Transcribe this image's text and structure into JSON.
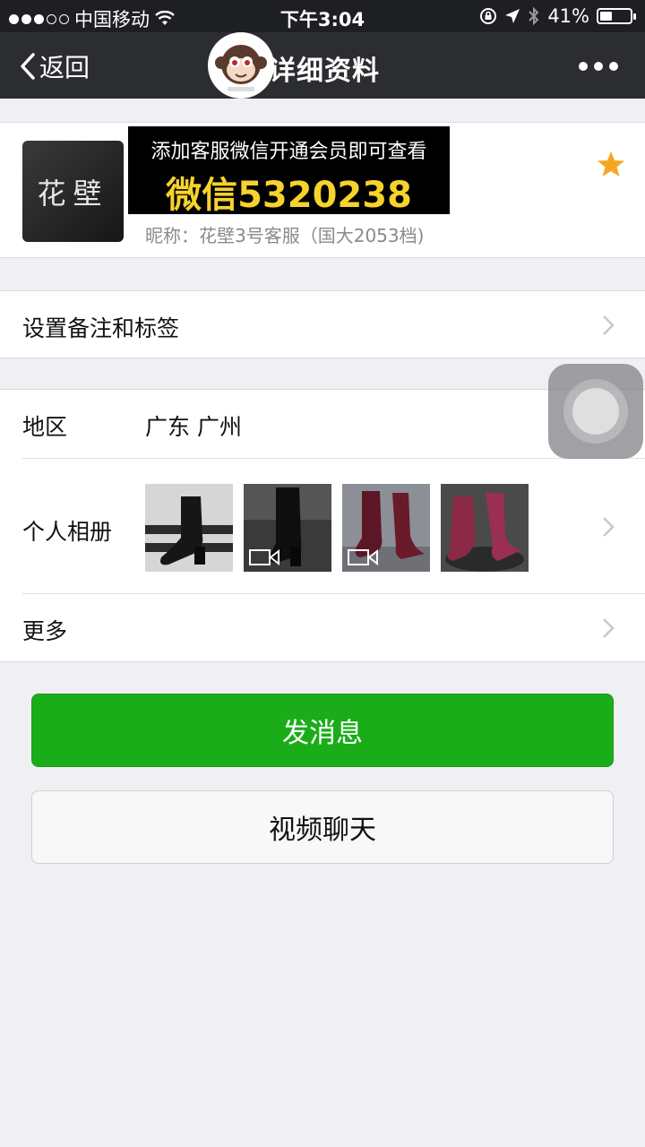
{
  "status_bar": {
    "carrier": "中国移动",
    "time": "下午3:04",
    "battery_text": "41%",
    "battery_level": 0.41
  },
  "nav": {
    "back_label": "返回",
    "title": "详细资料",
    "overlay_badge_name": "monkey-logo-icon"
  },
  "profile": {
    "avatar_text": "花壁",
    "banner_line1": "添加客服微信开通会员即可查看",
    "banner_line2": "微信5320238",
    "nickname": "昵称：花壁3号客服（国大2053档)",
    "starred": true,
    "colors": {
      "banner_bg": "#000000",
      "banner_highlight": "#f6d22c",
      "star": "#f5a623"
    }
  },
  "settings": {
    "remark_label": "设置备注和标签"
  },
  "info": {
    "region_label": "地区",
    "region_value": "广东 广州",
    "album_label": "个人相册",
    "album_thumbs": [
      {
        "name": "black-ankle-boot-photo",
        "video": false
      },
      {
        "name": "black-sock-boot-video",
        "video": true
      },
      {
        "name": "burgundy-suede-boots-video",
        "video": true
      },
      {
        "name": "wine-suede-boots-photo",
        "video": false
      }
    ],
    "more_label": "更多"
  },
  "actions": {
    "send_message": "发消息",
    "video_chat": "视频聊天",
    "colors": {
      "primary": "#1aad19"
    }
  }
}
